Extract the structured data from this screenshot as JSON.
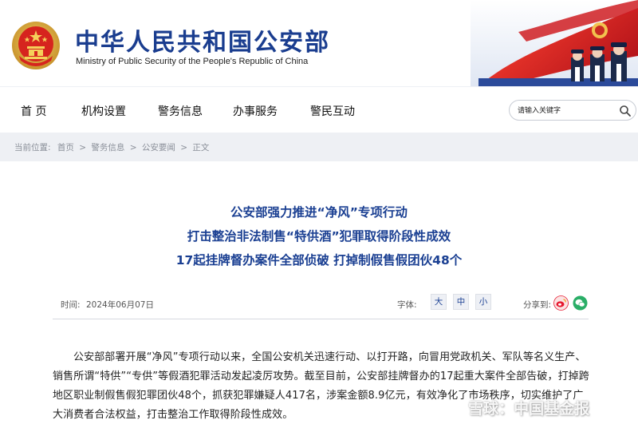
{
  "header": {
    "title": "中华人民共和国公安部",
    "subtitle": "Ministry of Public Security of the People's Republic of China"
  },
  "nav": {
    "items": [
      "首 页",
      "机构设置",
      "警务信息",
      "办事服务",
      "警民互动"
    ]
  },
  "search": {
    "placeholder": "请输入关键字",
    "value": ""
  },
  "breadcrumb": {
    "prefix": "当前位置:",
    "items": [
      "首页",
      "警务信息",
      "公安要闻",
      "正文"
    ],
    "separator": ">"
  },
  "article": {
    "headline": [
      "公安部强力推进“净风”专项行动",
      "打击整治非法制售“特供酒”犯罪取得阶段性成效",
      "17起挂牌督办案件全部侦破 打掉制假售假团伙48个"
    ],
    "date_label": "时间:",
    "date": "2024年06月07日",
    "font_label": "字体:",
    "font_sizes": [
      "大",
      "中",
      "小"
    ],
    "share_label": "分享到:",
    "share_targets": [
      "weibo-icon",
      "wechat-icon"
    ],
    "body": "公安部部署开展“净风”专项行动以来，全国公安机关迅速行动、以打开路，向冒用党政机关、军队等名义生产、销售所谓“特供”“专供”等假酒犯罪活动发起凌厉攻势。截至目前，公安部挂牌督办的17起重大案件全部告破，打掉跨地区职业制假售假犯罪团伙48个，抓获犯罪嫌疑人417名，涉案金额8.9亿元，有效净化了市场秩序，切实维护了广大消费者合法权益，打击整治工作取得阶段性成效。"
  },
  "watermark": {
    "text": "雪球：中国基金报"
  },
  "colors": {
    "brand_blue": "#1a3d8f",
    "headline_blue": "#1a3f92",
    "crumb_bg": "#eef0f4",
    "weibo": "#e6162d",
    "wechat": "#2aae67"
  }
}
